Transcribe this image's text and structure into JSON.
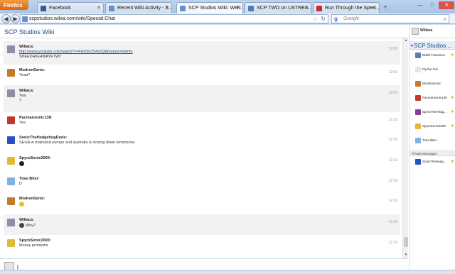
{
  "browser": {
    "app_name": "Firefox",
    "tabs": [
      {
        "label": "Facebook",
        "color": "#3b5998"
      },
      {
        "label": "Recent Wiki Activity - S...",
        "color": "#6a8fc7"
      },
      {
        "label": "SCP Studios Wiki: Welc...",
        "color": "#6a8fc7",
        "active": true
      },
      {
        "label": "SCP TWO on USTREA...",
        "color": "#4a7fc1"
      },
      {
        "label": "Run Through the Spee...",
        "color": "#cc2b2b"
      }
    ],
    "new_tab_glyph": "+",
    "url": "scpstudios.wikia.com/wiki/Special:Chat",
    "search_placeholder": "Google",
    "search_engine_glyph": "g"
  },
  "page": {
    "wiki_title": "SCP Studios Wiki",
    "current_user": "Willaca"
  },
  "messages": [
    {
      "user": "Willaca:",
      "lines": [
        "http://www.youtube.com/watch?v=FHhSh2S4s0Q&feature=relmfu",
        "SPEEDHIGHWAYFTW!!"
      ],
      "link_first": true,
      "time": "12:08",
      "shaded": true,
      "avatar_color": "#8a8fa8"
    },
    {
      "user": "ModrenSonic:",
      "lines": [
        "Yeaa?"
      ],
      "time": "12:09",
      "shaded": false,
      "avatar_color": "#c47a2c"
    },
    {
      "user": "Willaca:",
      "lines": [
        "Yea",
        "?"
      ],
      "time": "12:09",
      "shaded": true,
      "avatar_color": "#8a8fa8"
    },
    {
      "user": "Pacmansonic138:",
      "lines": [
        "Yes"
      ],
      "time": "12:10",
      "shaded": false,
      "avatar_color": "#c0392b"
    },
    {
      "user": "SonicTheHedgehogDude:",
      "lines": [
        "SEGA in mainland europe and austraila is closing down tommorow"
      ],
      "time": "12:10",
      "shaded": false,
      "avatar_color": "#2b4fbf"
    },
    {
      "user": "SpyroSonic2000:",
      "lines": [
        ""
      ],
      "emote": "#222222",
      "time": "12:10",
      "shaded": false,
      "avatar_color": "#e0b93a"
    },
    {
      "user": "Time Biter:",
      "lines": [
        "D"
      ],
      "time": "12:10",
      "shaded": false,
      "avatar_color": "#7fb2e0"
    },
    {
      "user": "ModrenSonic:",
      "lines": [
        ""
      ],
      "emote": "#e6c12f",
      "time": "12:10",
      "shaded": false,
      "avatar_color": "#c47a2c"
    },
    {
      "user": "Willaca:",
      "lines": [
        "Why?"
      ],
      "emote": "#444444",
      "time": "12:10",
      "shaded": true,
      "avatar_color": "#8a8fa8"
    },
    {
      "user": "SpyroSonic2000:",
      "lines": [
        "Money problems"
      ],
      "time": "12:10",
      "shaded": false,
      "avatar_color": "#e0b93a"
    }
  ],
  "sidebar": {
    "room_title": "SCP Studios ...",
    "members": [
      {
        "name": "Bullet Francisco",
        "color": "#5d7fa8",
        "admin": true
      },
      {
        "name": "Fly the Fox",
        "color": "#e6e6e6",
        "admin": false
      },
      {
        "name": "ModrenSonic",
        "color": "#c47a2c",
        "admin": false
      },
      {
        "name": "Pacmansonic138",
        "color": "#c0392b",
        "admin": true
      },
      {
        "name": "SpyroTheHedg...",
        "color": "#8e3c8e",
        "admin": true
      },
      {
        "name": "SpyroSonic2000",
        "color": "#e0b93a",
        "admin": true
      },
      {
        "name": "Time Biter",
        "color": "#7fb2e0",
        "admin": false
      }
    ],
    "private_messages_label": "Private Messages",
    "private_messages": [
      {
        "name": "SonicTheHedg...",
        "color": "#2b4fbf",
        "admin": true
      }
    ]
  },
  "input": {
    "value": "|"
  }
}
